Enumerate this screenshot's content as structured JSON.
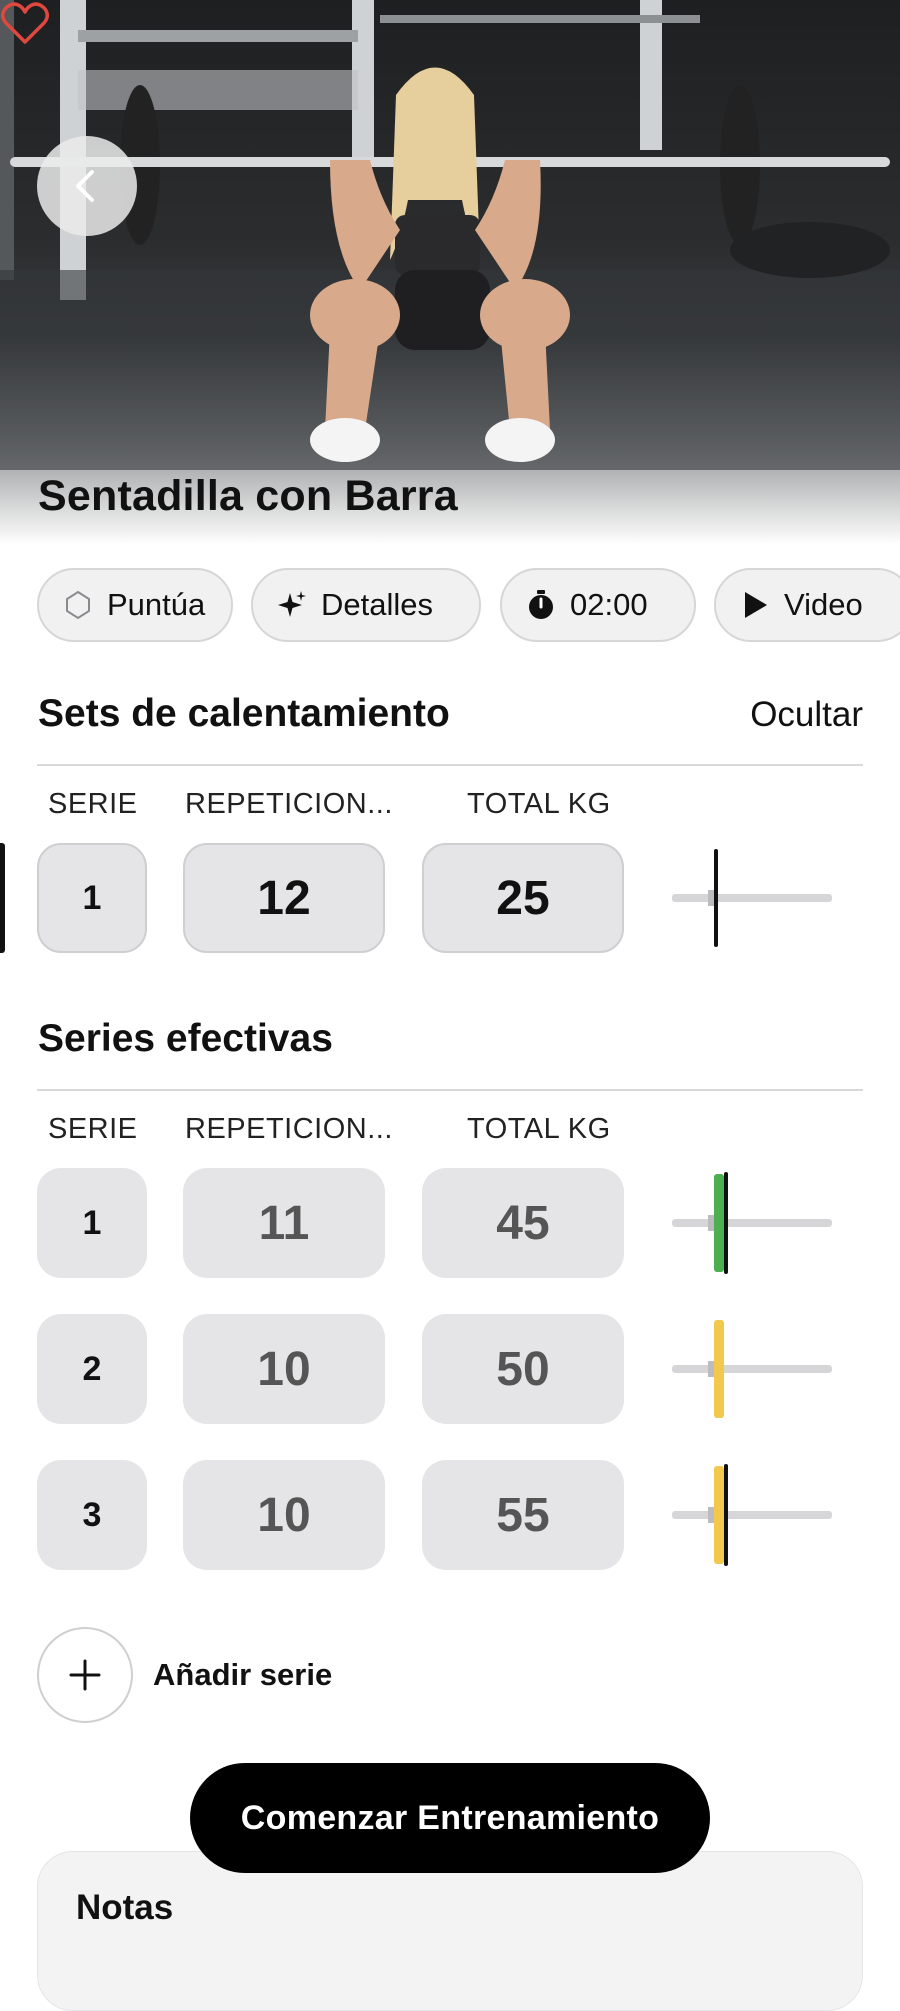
{
  "exercise": {
    "title": "Sentadilla con Barra",
    "favorite_icon": "heart-outline-icon",
    "back_icon": "chevron-left-icon"
  },
  "chips": [
    {
      "label": "Puntúa",
      "icon": "rating-outline-icon"
    },
    {
      "label": "Detalles",
      "icon": "sparkles-icon"
    },
    {
      "label": "02:00",
      "icon": "stopwatch-icon"
    },
    {
      "label": "Video",
      "icon": "play-icon"
    }
  ],
  "warmup": {
    "title": "Sets de calentamiento",
    "hide_label": "Ocultar",
    "columns": {
      "serie": "SERIE",
      "reps": "REPETICION...",
      "kg": "TOTAL KG"
    },
    "rows": [
      {
        "serie": "1",
        "reps": "12",
        "kg": "25",
        "plate_color": "none"
      }
    ]
  },
  "effective": {
    "title": "Series efectivas",
    "columns": {
      "serie": "SERIE",
      "reps": "REPETICION...",
      "kg": "TOTAL KG"
    },
    "rows": [
      {
        "serie": "1",
        "reps": "11",
        "kg": "45",
        "plate_color": "#4caf50"
      },
      {
        "serie": "2",
        "reps": "10",
        "kg": "50",
        "plate_color": "#f2c94c"
      },
      {
        "serie": "3",
        "reps": "10",
        "kg": "55",
        "plate_color": "#f2c94c"
      }
    ]
  },
  "add_set": {
    "label": "Añadir serie",
    "icon": "plus-icon"
  },
  "start_button": {
    "label": "Comenzar Entrenamiento"
  },
  "notes": {
    "title": "Notas"
  },
  "colors": {
    "accent": "#000000",
    "heart": "#e0473e",
    "cell_bg": "#e5e5e7",
    "green_plate": "#4caf50",
    "yellow_plate": "#f2c94c"
  }
}
